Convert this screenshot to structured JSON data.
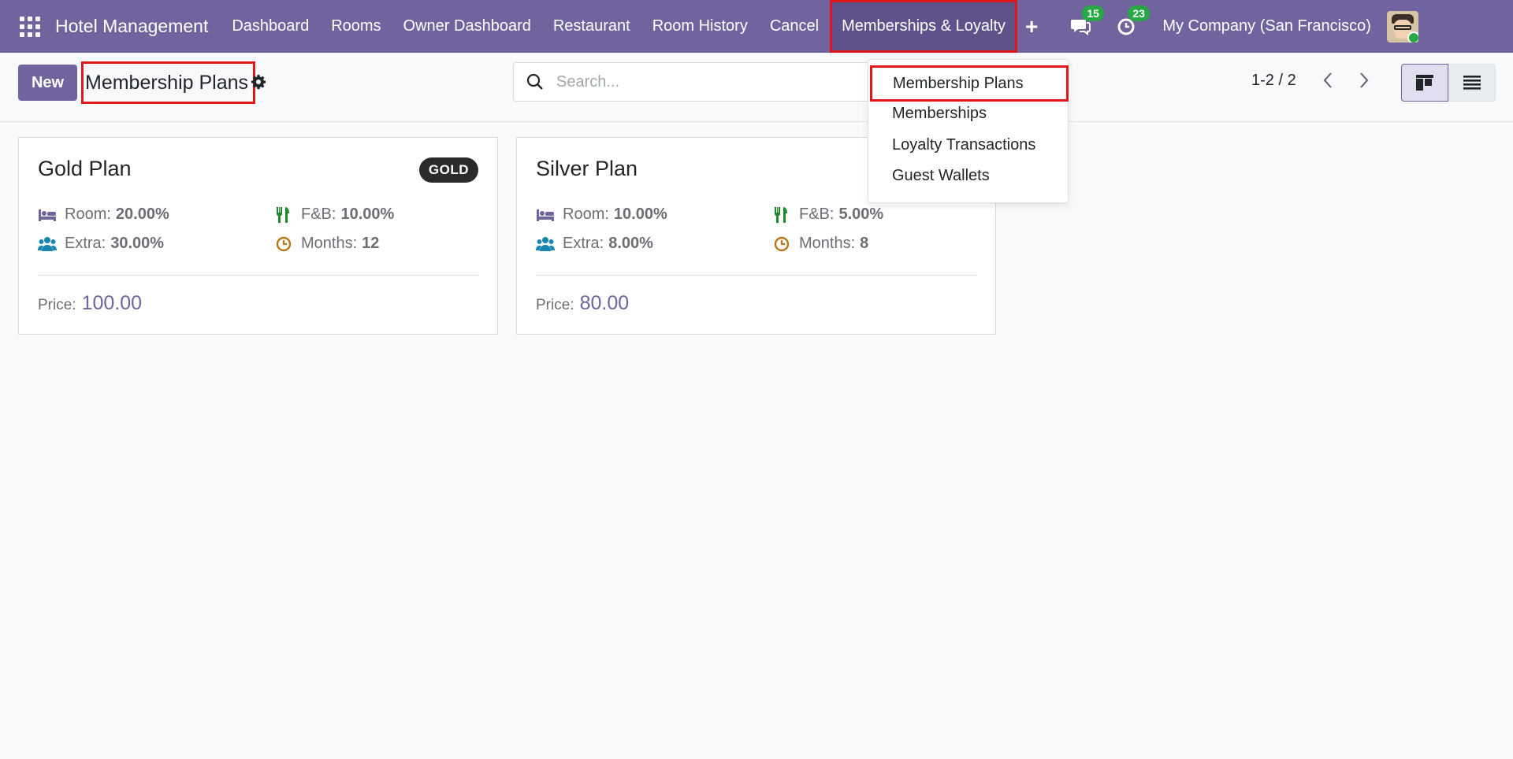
{
  "navbar": {
    "brand": "Hotel Management",
    "menu": [
      "Dashboard",
      "Rooms",
      "Owner Dashboard",
      "Restaurant",
      "Room History",
      "Cancel",
      "Memberships & Loyalty"
    ],
    "plus": "+",
    "messages_count": "15",
    "activities_count": "23",
    "company": "My Company (San Francisco)"
  },
  "control": {
    "new_label": "New",
    "title": "Membership Plans",
    "search_placeholder": "Search...",
    "pager": "1-2 / 2"
  },
  "dropdown": {
    "items": [
      "Membership Plans",
      "Memberships",
      "Loyalty Transactions",
      "Guest Wallets"
    ]
  },
  "cards": [
    {
      "title": "Gold Plan",
      "tag": "GOLD",
      "room_label": "Room:",
      "room": "20.00%",
      "fb_label": "F&B:",
      "fb": "10.00%",
      "extra_label": "Extra:",
      "extra": "30.00%",
      "months_label": "Months:",
      "months": "12",
      "price_label": "Price:",
      "price": "100.00"
    },
    {
      "title": "Silver Plan",
      "tag": "",
      "room_label": "Room:",
      "room": "10.00%",
      "fb_label": "F&B:",
      "fb": "5.00%",
      "extra_label": "Extra:",
      "extra": "8.00%",
      "months_label": "Months:",
      "months": "8",
      "price_label": "Price:",
      "price": "80.00"
    }
  ],
  "colors": {
    "navbar": "#71639e",
    "highlight": "#e0181b",
    "badge": "#28a745",
    "room_icon": "#71639e",
    "fb_icon": "#1e8a2e",
    "extra_icon": "#1a86b0",
    "months_icon": "#b9791a"
  }
}
